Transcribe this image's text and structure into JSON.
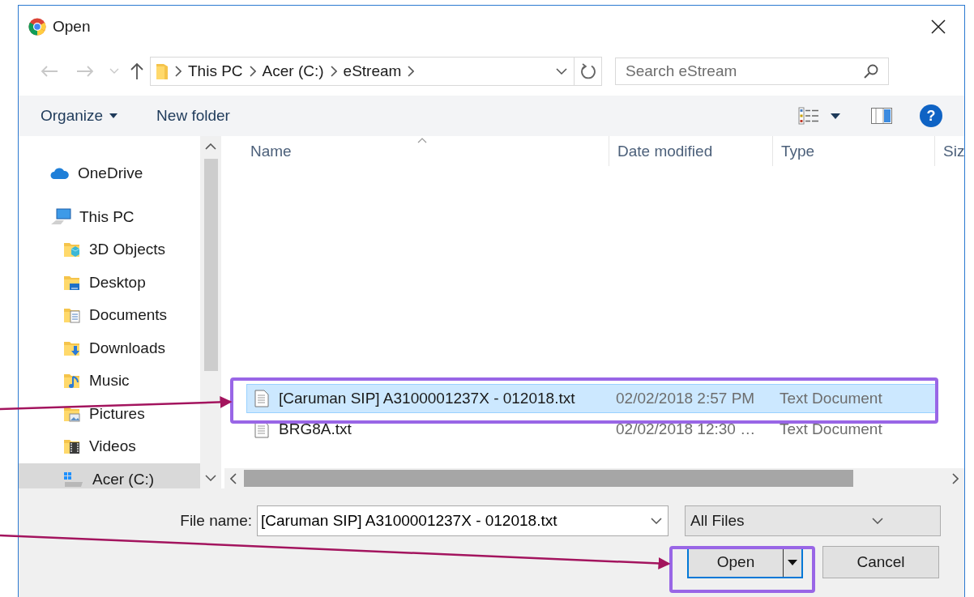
{
  "window": {
    "title": "Open"
  },
  "address_bar": {
    "path": [
      "This PC",
      "Acer (C:)",
      "eStream"
    ]
  },
  "search": {
    "placeholder": "Search eStream"
  },
  "toolbar": {
    "organize": "Organize",
    "new_folder": "New folder",
    "help": "?"
  },
  "sidebar": {
    "items": [
      {
        "label": "OneDrive",
        "kind": "cloud",
        "selected": false
      },
      {
        "label": "This PC",
        "kind": "computer",
        "selected": false,
        "children": [
          {
            "label": "3D Objects",
            "kind": "objects",
            "selected": false
          },
          {
            "label": "Desktop",
            "kind": "desktop",
            "selected": false
          },
          {
            "label": "Documents",
            "kind": "documents",
            "selected": false
          },
          {
            "label": "Downloads",
            "kind": "downloads",
            "selected": false
          },
          {
            "label": "Music",
            "kind": "music",
            "selected": false
          },
          {
            "label": "Pictures",
            "kind": "pictures",
            "selected": false
          },
          {
            "label": "Videos",
            "kind": "videos",
            "selected": false
          },
          {
            "label": "Acer (C:)",
            "kind": "drive",
            "selected": true
          }
        ]
      }
    ]
  },
  "file_list": {
    "columns": [
      "Name",
      "Date modified",
      "Type",
      "Siz"
    ],
    "rows": [
      {
        "name": "[Caruman SIP] A3100001237X - 012018.txt",
        "date": "02/02/2018 2:57 PM",
        "type": "Text Document",
        "selected": true
      },
      {
        "name": "BRG8A.txt",
        "date": "02/02/2018 12:30 …",
        "type": "Text Document",
        "selected": false
      }
    ]
  },
  "file_name": {
    "label": "File name:",
    "value": "[Caruman SIP] A3100001237X - 012018.txt"
  },
  "file_type": {
    "value": "All Files"
  },
  "buttons": [
    {
      "label": "Open",
      "kind": "split"
    },
    {
      "label": "Cancel",
      "kind": "plain"
    }
  ]
}
